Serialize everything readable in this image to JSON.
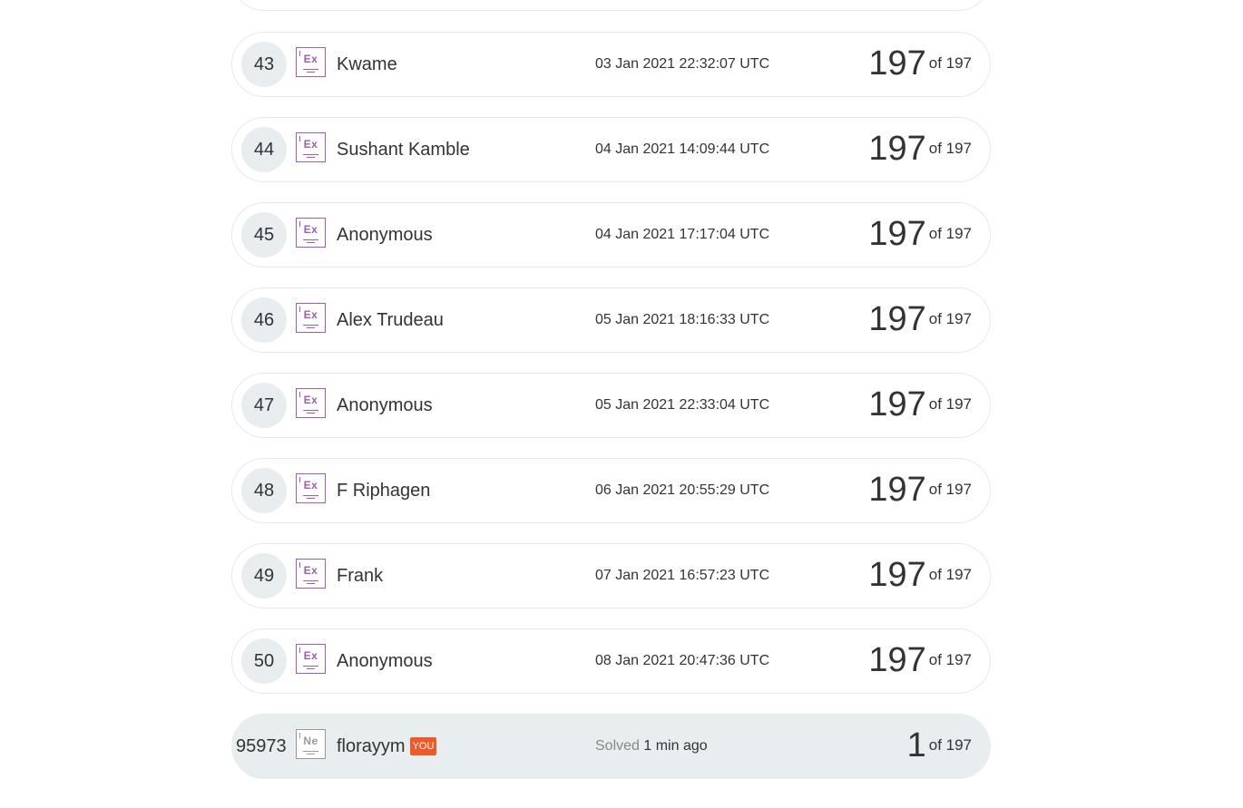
{
  "leaderboard": {
    "rows": [
      {
        "rank": "43",
        "badge": "Ex",
        "name": "Kwame",
        "date": "03 Jan 2021 22:32:07 UTC",
        "score": "197",
        "of_label": "of 197"
      },
      {
        "rank": "44",
        "badge": "Ex",
        "name": "Sushant Kamble",
        "date": "04 Jan 2021 14:09:44 UTC",
        "score": "197",
        "of_label": "of 197"
      },
      {
        "rank": "45",
        "badge": "Ex",
        "name": "Anonymous",
        "date": "04 Jan 2021 17:17:04 UTC",
        "score": "197",
        "of_label": "of 197"
      },
      {
        "rank": "46",
        "badge": "Ex",
        "name": "Alex Trudeau",
        "date": "05 Jan 2021 18:16:33 UTC",
        "score": "197",
        "of_label": "of 197"
      },
      {
        "rank": "47",
        "badge": "Ex",
        "name": "Anonymous",
        "date": "05 Jan 2021 22:33:04 UTC",
        "score": "197",
        "of_label": "of 197"
      },
      {
        "rank": "48",
        "badge": "Ex",
        "name": "F Riphagen",
        "date": "06 Jan 2021 20:55:29 UTC",
        "score": "197",
        "of_label": "of 197"
      },
      {
        "rank": "49",
        "badge": "Ex",
        "name": "Frank",
        "date": "07 Jan 2021 16:57:23 UTC",
        "score": "197",
        "of_label": "of 197"
      },
      {
        "rank": "50",
        "badge": "Ex",
        "name": "Anonymous",
        "date": "08 Jan 2021 20:47:36 UTC",
        "score": "197",
        "of_label": "of 197"
      }
    ],
    "current_user": {
      "rank": "95973",
      "badge": "Ne",
      "name": "florayym",
      "you_label": "YOU",
      "solved_label": "Solved",
      "solved_time": "1 min ago",
      "score": "1",
      "of_label": "of 197"
    }
  },
  "colors": {
    "expert_badge": "#9a5fb0",
    "newbie_badge": "#999999",
    "you_tag": "#f05a28",
    "highlight_row": "#e8edf0",
    "rank_circle": "#e8edf0"
  },
  "icons": {
    "expert": "expert-level-badge-icon",
    "newbie": "newbie-level-badge-icon"
  }
}
